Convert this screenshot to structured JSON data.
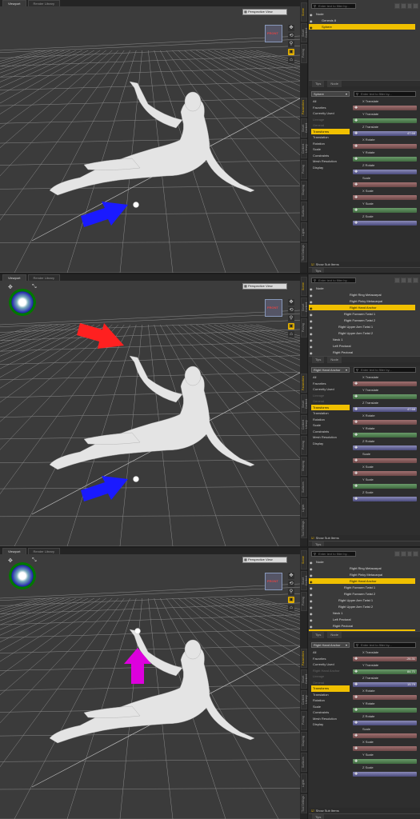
{
  "viewport_tabs": [
    "Viewport",
    "Render Library"
  ],
  "view_dropdown": "Perspective View",
  "cube_label": "FRONT",
  "vertical_tabs_1": [
    "Scene",
    "Smart Content",
    "Posing",
    "Shaping",
    "Surfaces",
    "Lights",
    "Tool Settings"
  ],
  "vertical_tabs_2": [
    "Parameters",
    "Smart Content",
    "Content Library",
    "Posing",
    "Shaping",
    "Surfaces",
    "Lights",
    "Tool Settings"
  ],
  "search_placeholder": "Enter text to filter by...",
  "tips_tabs": [
    "Tips",
    "Node"
  ],
  "tips_tab": "Tips",
  "show_sub_items": "Show Sub Items",
  "panels": [
    {
      "scene_rows": [
        {
          "label": "Node",
          "selected": false,
          "indent": 0
        },
        {
          "label": "Genesis 8",
          "selected": false,
          "indent": 1
        },
        {
          "label": "Sphere",
          "selected": true,
          "indent": 1
        }
      ],
      "param_node": "Sphere",
      "param_list": [
        {
          "label": "All",
          "selected": false,
          "gray": false
        },
        {
          "label": "Favorites",
          "selected": false,
          "gray": false
        },
        {
          "label": "Currently Used",
          "selected": false,
          "gray": false
        },
        {
          "label": "Lineage",
          "selected": false,
          "gray": true
        },
        {
          "label": "General",
          "selected": false,
          "gray": true
        },
        {
          "label": "Transforms",
          "selected": true,
          "gray": false
        },
        {
          "label": "Translation",
          "selected": false,
          "gray": false
        },
        {
          "label": "Rotation",
          "selected": false,
          "gray": false
        },
        {
          "label": "Scale",
          "selected": false,
          "gray": false
        },
        {
          "label": "Constraints",
          "selected": false,
          "gray": false
        },
        {
          "label": "Mesh Resolution",
          "selected": false,
          "gray": false
        },
        {
          "label": "Display",
          "selected": false,
          "gray": false
        }
      ],
      "sliders": [
        {
          "label": "X Translate",
          "color": "red",
          "value": ""
        },
        {
          "label": "Y Translate",
          "color": "green",
          "value": ""
        },
        {
          "label": "Z Translate",
          "color": "blue",
          "value": "47.68"
        },
        {
          "label": "X Rotate",
          "color": "red",
          "value": ""
        },
        {
          "label": "Y Rotate",
          "color": "green",
          "value": ""
        },
        {
          "label": "Z Rotate",
          "color": "blue",
          "value": ""
        },
        {
          "label": "Scale",
          "color": "red",
          "value": ""
        },
        {
          "label": "X Scale",
          "color": "red",
          "value": ""
        },
        {
          "label": "Y Scale",
          "color": "green",
          "value": ""
        },
        {
          "label": "Z Scale",
          "color": "blue",
          "value": ""
        }
      ]
    },
    {
      "scene_rows": [
        {
          "label": "Node",
          "selected": false,
          "indent": 0
        },
        {
          "label": "Right Ring Metacarpal",
          "selected": false,
          "indent": 6
        },
        {
          "label": "Right Pinky Metacarpal",
          "selected": false,
          "indent": 6
        },
        {
          "label": "Right Hand Anchor",
          "selected": true,
          "indent": 6
        },
        {
          "label": "Right Forearm Twist 1",
          "selected": false,
          "indent": 5
        },
        {
          "label": "Right Forearm Twist 2",
          "selected": false,
          "indent": 5
        },
        {
          "label": "Right Upper Arm Twist 1",
          "selected": false,
          "indent": 4
        },
        {
          "label": "Right Upper Arm Twist 2",
          "selected": false,
          "indent": 4
        },
        {
          "label": "Neck 1",
          "selected": false,
          "indent": 3
        },
        {
          "label": "Left Pectoral",
          "selected": false,
          "indent": 3
        },
        {
          "label": "Right Pectoral",
          "selected": false,
          "indent": 3
        },
        {
          "label": "Sphere",
          "selected": true,
          "indent": 1
        }
      ],
      "param_node": "Right Hand Anchor",
      "param_list": [
        {
          "label": "All",
          "selected": false,
          "gray": false
        },
        {
          "label": "Favorites",
          "selected": false,
          "gray": false
        },
        {
          "label": "Currently Used",
          "selected": false,
          "gray": false
        },
        {
          "label": "Lineage",
          "selected": false,
          "gray": true
        },
        {
          "label": "General",
          "selected": false,
          "gray": true
        },
        {
          "label": "Transforms",
          "selected": true,
          "gray": false
        },
        {
          "label": "Translation",
          "selected": false,
          "gray": false
        },
        {
          "label": "Rotation",
          "selected": false,
          "gray": false
        },
        {
          "label": "Scale",
          "selected": false,
          "gray": false
        },
        {
          "label": "Constraints",
          "selected": false,
          "gray": false
        },
        {
          "label": "Mesh Resolution",
          "selected": false,
          "gray": false
        },
        {
          "label": "Display",
          "selected": false,
          "gray": false
        }
      ],
      "sliders": [
        {
          "label": "X Translate",
          "color": "red",
          "value": ""
        },
        {
          "label": "Y Translate",
          "color": "green",
          "value": ""
        },
        {
          "label": "Z Translate",
          "color": "blue",
          "value": "47.68"
        },
        {
          "label": "X Rotate",
          "color": "red",
          "value": ""
        },
        {
          "label": "Y Rotate",
          "color": "green",
          "value": ""
        },
        {
          "label": "Z Rotate",
          "color": "blue",
          "value": ""
        },
        {
          "label": "Scale",
          "color": "red",
          "value": ""
        },
        {
          "label": "X Scale",
          "color": "red",
          "value": ""
        },
        {
          "label": "Y Scale",
          "color": "green",
          "value": ""
        },
        {
          "label": "Z Scale",
          "color": "blue",
          "value": ""
        }
      ]
    },
    {
      "scene_rows": [
        {
          "label": "Node",
          "selected": false,
          "indent": 0
        },
        {
          "label": "Right Ring Metacarpal",
          "selected": false,
          "indent": 6
        },
        {
          "label": "Right Pinky Metacarpal",
          "selected": false,
          "indent": 6
        },
        {
          "label": "Right Hand Anchor",
          "selected": true,
          "indent": 6
        },
        {
          "label": "Right Forearm Twist 1",
          "selected": false,
          "indent": 5
        },
        {
          "label": "Right Forearm Twist 2",
          "selected": false,
          "indent": 5
        },
        {
          "label": "Right Upper Arm Twist 1",
          "selected": false,
          "indent": 4
        },
        {
          "label": "Right Upper Arm Twist 2",
          "selected": false,
          "indent": 4
        },
        {
          "label": "Neck 1",
          "selected": false,
          "indent": 3
        },
        {
          "label": "Left Pectoral",
          "selected": false,
          "indent": 3
        },
        {
          "label": "Right Pectoral",
          "selected": false,
          "indent": 3
        },
        {
          "label": "Sphere",
          "selected": true,
          "indent": 1
        }
      ],
      "param_node": "Right Hand Anchor",
      "param_list": [
        {
          "label": "All",
          "selected": false,
          "gray": false
        },
        {
          "label": "Favorites",
          "selected": false,
          "gray": false
        },
        {
          "label": "Currently Used",
          "selected": false,
          "gray": false
        },
        {
          "label": "Right Hand Anchor",
          "selected": false,
          "gray": true
        },
        {
          "label": "Lineage",
          "selected": false,
          "gray": true
        },
        {
          "label": "General",
          "selected": false,
          "gray": true
        },
        {
          "label": "Transforms",
          "selected": true,
          "gray": false
        },
        {
          "label": "Translation",
          "selected": false,
          "gray": false
        },
        {
          "label": "Rotation",
          "selected": false,
          "gray": false
        },
        {
          "label": "Scale",
          "selected": false,
          "gray": false
        },
        {
          "label": "Constraints",
          "selected": false,
          "gray": false
        },
        {
          "label": "Mesh Resolution",
          "selected": false,
          "gray": false
        },
        {
          "label": "Display",
          "selected": false,
          "gray": false
        }
      ],
      "sliders": [
        {
          "label": "X Translate",
          "color": "red",
          "value": "-26.31"
        },
        {
          "label": "Y Translate",
          "color": "green",
          "value": "84.71"
        },
        {
          "label": "Z Translate",
          "color": "blue",
          "value": "15.79"
        },
        {
          "label": "X Rotate",
          "color": "red",
          "value": ""
        },
        {
          "label": "Y Rotate",
          "color": "green",
          "value": ""
        },
        {
          "label": "Z Rotate",
          "color": "blue",
          "value": ""
        },
        {
          "label": "Scale",
          "color": "red",
          "value": ""
        },
        {
          "label": "X Scale",
          "color": "red",
          "value": ""
        },
        {
          "label": "Y Scale",
          "color": "green",
          "value": ""
        },
        {
          "label": "Z Scale",
          "color": "blue",
          "value": ""
        }
      ]
    }
  ],
  "colors": {
    "selection": "#f0c000",
    "arrow_blue": "#1a1aff",
    "arrow_red": "#ff2020",
    "arrow_magenta": "#dd00dd"
  }
}
